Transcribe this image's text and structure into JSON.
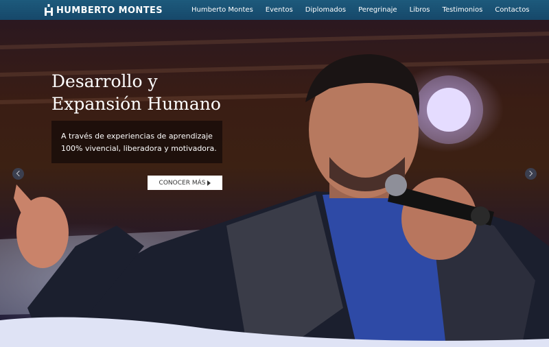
{
  "brand": {
    "name": "HUMBERTO MONTES",
    "icon": "hm-logo-icon"
  },
  "nav": {
    "items": [
      "Humberto Montes",
      "Eventos",
      "Diplomados",
      "Peregrinaje",
      "Libros",
      "Testimonios",
      "Contactos"
    ]
  },
  "hero": {
    "headline_line1": "Desarrollo y",
    "headline_line2": "Expansión Humano",
    "description": "A través de experiencias de aprendizaje 100% vivencial, liberadora y motivadora.",
    "cta_label": "CONOCER MÁS",
    "image": "speaker-with-microphone"
  },
  "colors": {
    "navbar": "#1d5a7c",
    "wave": "#dfe3f5"
  }
}
